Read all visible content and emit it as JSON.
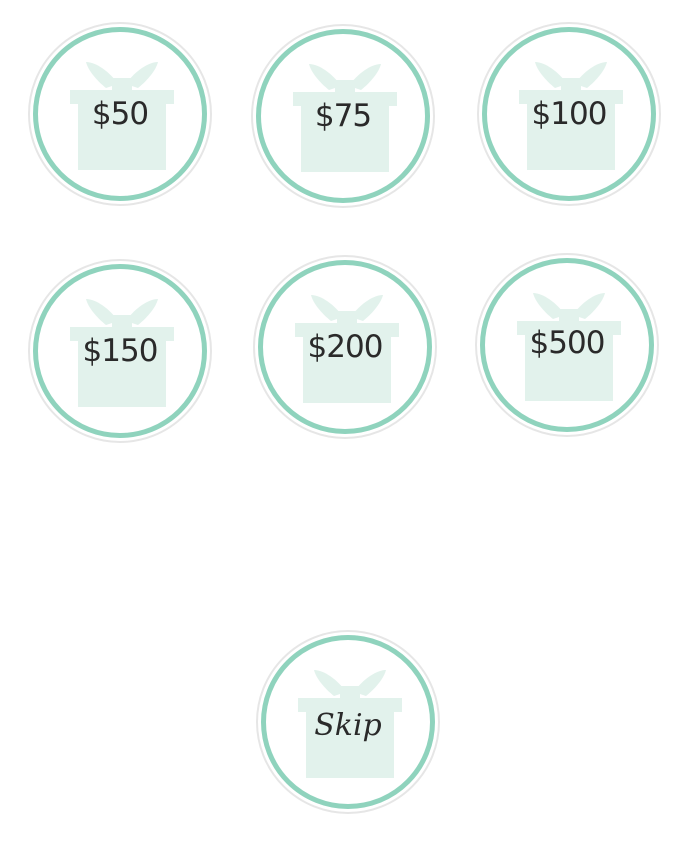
{
  "colors": {
    "ring": "#8fd3bd",
    "outer_ring": "#e6e6e6",
    "gift_fill": "#e2f2ec",
    "label": "#2a2a2a"
  },
  "options": [
    {
      "label": "$50",
      "icon": "gift-icon"
    },
    {
      "label": "$75",
      "icon": "gift-icon"
    },
    {
      "label": "$100",
      "icon": "gift-icon"
    },
    {
      "label": "$150",
      "icon": "gift-icon"
    },
    {
      "label": "$200",
      "icon": "gift-icon"
    },
    {
      "label": "$500",
      "icon": "gift-icon"
    }
  ],
  "skip": {
    "label": "Skip",
    "icon": "gift-icon"
  }
}
